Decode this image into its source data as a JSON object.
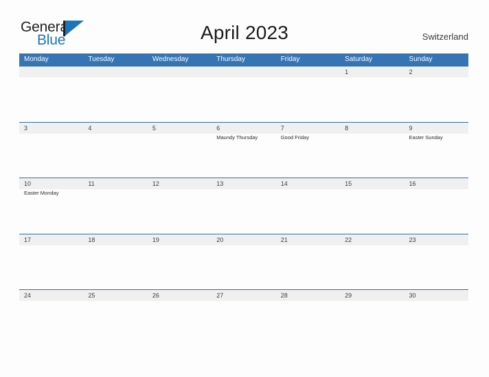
{
  "brand": {
    "word1": "General",
    "word2": "Blue",
    "flag_icon": "flag-triangle-icon",
    "accent_color": "#1b75bb"
  },
  "header": {
    "title": "April 2023",
    "country": "Switzerland"
  },
  "theme": {
    "header_blue": "#3575b4",
    "divider_blue": "#2e6da4",
    "band_gray": "#f0f0f0",
    "page_background": "#fdfdfd"
  },
  "calendar": {
    "weekdays": [
      "Monday",
      "Tuesday",
      "Wednesday",
      "Thursday",
      "Friday",
      "Saturday",
      "Sunday"
    ],
    "weeks": [
      [
        {
          "day": "",
          "event": ""
        },
        {
          "day": "",
          "event": ""
        },
        {
          "day": "",
          "event": ""
        },
        {
          "day": "",
          "event": ""
        },
        {
          "day": "",
          "event": ""
        },
        {
          "day": "1",
          "event": ""
        },
        {
          "day": "2",
          "event": ""
        }
      ],
      [
        {
          "day": "3",
          "event": ""
        },
        {
          "day": "4",
          "event": ""
        },
        {
          "day": "5",
          "event": ""
        },
        {
          "day": "6",
          "event": "Maundy Thursday"
        },
        {
          "day": "7",
          "event": "Good Friday"
        },
        {
          "day": "8",
          "event": ""
        },
        {
          "day": "9",
          "event": "Easter Sunday"
        }
      ],
      [
        {
          "day": "10",
          "event": "Easter Monday"
        },
        {
          "day": "11",
          "event": ""
        },
        {
          "day": "12",
          "event": ""
        },
        {
          "day": "13",
          "event": ""
        },
        {
          "day": "14",
          "event": ""
        },
        {
          "day": "15",
          "event": ""
        },
        {
          "day": "16",
          "event": ""
        }
      ],
      [
        {
          "day": "17",
          "event": ""
        },
        {
          "day": "18",
          "event": ""
        },
        {
          "day": "19",
          "event": ""
        },
        {
          "day": "20",
          "event": ""
        },
        {
          "day": "21",
          "event": ""
        },
        {
          "day": "22",
          "event": ""
        },
        {
          "day": "23",
          "event": ""
        }
      ],
      [
        {
          "day": "24",
          "event": ""
        },
        {
          "day": "25",
          "event": ""
        },
        {
          "day": "26",
          "event": ""
        },
        {
          "day": "27",
          "event": ""
        },
        {
          "day": "28",
          "event": ""
        },
        {
          "day": "29",
          "event": ""
        },
        {
          "day": "30",
          "event": ""
        }
      ]
    ]
  }
}
